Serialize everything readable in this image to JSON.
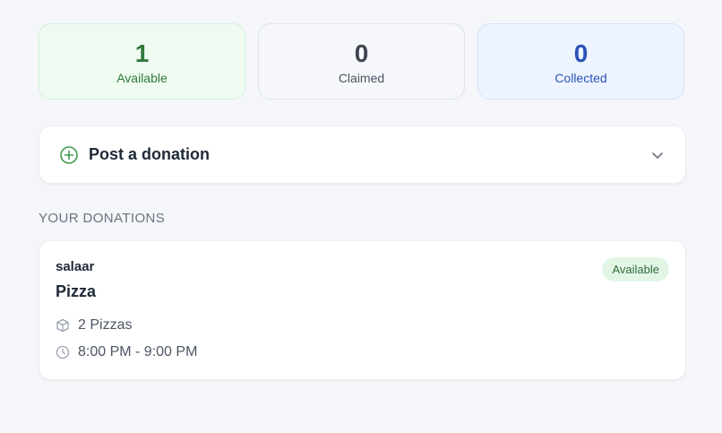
{
  "stats": [
    {
      "value": "1",
      "label": "Available"
    },
    {
      "value": "0",
      "label": "Claimed"
    },
    {
      "value": "0",
      "label": "Collected"
    }
  ],
  "post_donation": {
    "title": "Post a donation",
    "icon": "plus-circle-icon",
    "toggle_icon": "chevron-down-icon"
  },
  "section": {
    "title": "YOUR DONATIONS"
  },
  "donations": [
    {
      "donor": "salaar",
      "item": "Pizza",
      "status": "Available",
      "quantity": "2 Pizzas",
      "time": "8:00 PM - 9:00 PM",
      "quantity_icon": "package-icon",
      "time_icon": "clock-icon"
    }
  ],
  "colors": {
    "available": "#2f7a3c",
    "collected": "#2a52b8",
    "badge_bg": "#e3f6e6"
  }
}
